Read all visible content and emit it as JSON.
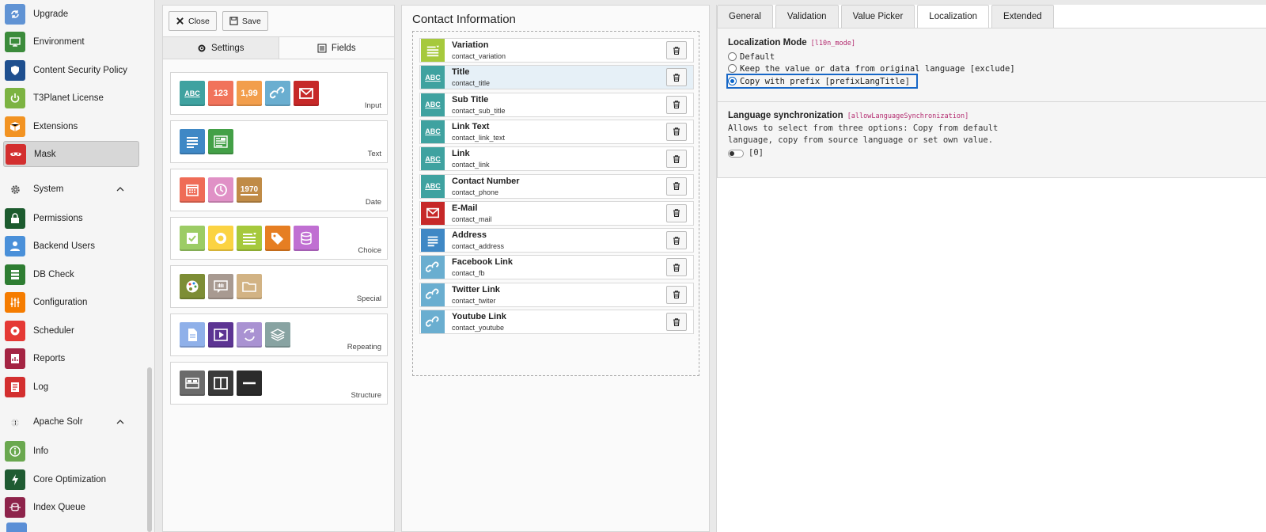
{
  "module_menu": {
    "items": [
      {
        "label": "Upgrade",
        "icon": "upgrade-icon",
        "color": "#6093d4"
      },
      {
        "label": "Environment",
        "icon": "environment-icon",
        "color": "#3b8b3b"
      },
      {
        "label": "Content Security Policy",
        "icon": "shield-icon",
        "color": "#1e4f8f"
      },
      {
        "label": "T3Planet License",
        "icon": "power-icon",
        "color": "#7cb342"
      },
      {
        "label": "Extensions",
        "icon": "box-icon",
        "color": "#f29322"
      },
      {
        "label": "Mask",
        "icon": "mask-icon",
        "color": "#d32f2f"
      }
    ],
    "system_group": {
      "label": "System",
      "icon": "gear-icon"
    },
    "system_items": [
      {
        "label": "Permissions",
        "icon": "lock-icon",
        "color": "#1c5b2e"
      },
      {
        "label": "Backend Users",
        "icon": "user-icon",
        "color": "#4a90d9"
      },
      {
        "label": "DB Check",
        "icon": "database-icon",
        "color": "#2e7d32"
      },
      {
        "label": "Configuration",
        "icon": "sliders-icon",
        "color": "#f57c00"
      },
      {
        "label": "Scheduler",
        "icon": "scheduler-icon",
        "color": "#e53935"
      },
      {
        "label": "Reports",
        "icon": "reports-icon",
        "color": "#a42443"
      },
      {
        "label": "Log",
        "icon": "log-icon",
        "color": "#d32f2f"
      }
    ],
    "solr_group": {
      "label": "Apache Solr",
      "icon": "solr-icon"
    },
    "solr_items": [
      {
        "label": "Info",
        "icon": "info-icon",
        "color": "#6aa84f"
      },
      {
        "label": "Core Optimization",
        "icon": "lightning-icon",
        "color": "#1f5b32"
      },
      {
        "label": "Index Queue",
        "icon": "queue-icon",
        "color": "#8e244b"
      }
    ]
  },
  "toolbar": {
    "close_label": "Close",
    "save_label": "Save"
  },
  "subtabs": {
    "settings": "Settings",
    "fields": "Fields"
  },
  "field_groups": [
    {
      "label": "Input",
      "icons": [
        {
          "name": "string-field-icon",
          "text": "ABC",
          "color": "#3fa2a0"
        },
        {
          "name": "integer-field-icon",
          "text": "123",
          "color": "#f1735b"
        },
        {
          "name": "float-field-icon",
          "text": "1,99",
          "color": "#f29e4c"
        },
        {
          "name": "link-field-icon",
          "text": "",
          "color": "#6aaed0"
        },
        {
          "name": "email-field-icon",
          "text": "",
          "color": "#c62828"
        }
      ]
    },
    {
      "label": "Text",
      "icons": [
        {
          "name": "textarea-field-icon",
          "text": "",
          "color": "#3f88c5"
        },
        {
          "name": "richtext-field-icon",
          "text": "",
          "color": "#43a047"
        }
      ]
    },
    {
      "label": "Date",
      "icons": [
        {
          "name": "date-field-icon",
          "text": "",
          "color": "#ef6c57"
        },
        {
          "name": "time-field-icon",
          "text": "",
          "color": "#e091c6"
        },
        {
          "name": "timestamp-field-icon",
          "text": "1970",
          "color": "#c08b46"
        }
      ]
    },
    {
      "label": "Choice",
      "icons": [
        {
          "name": "checkbox-field-icon",
          "text": "",
          "color": "#9ccc65"
        },
        {
          "name": "radio-field-icon",
          "text": "",
          "color": "#fbd342"
        },
        {
          "name": "select-field-icon",
          "text": "",
          "color": "#a6c93c"
        },
        {
          "name": "category-field-icon",
          "text": "",
          "color": "#e67e22"
        },
        {
          "name": "group-field-icon",
          "text": "",
          "color": "#c06fd2"
        }
      ]
    },
    {
      "label": "Special",
      "icons": [
        {
          "name": "colorpicker-field-icon",
          "text": "",
          "color": "#7d8d35"
        },
        {
          "name": "tab-field-icon",
          "text": "",
          "color": "#a89a91"
        },
        {
          "name": "folder-field-icon",
          "text": "",
          "color": "#d2b384"
        }
      ]
    },
    {
      "label": "Repeating",
      "icons": [
        {
          "name": "file-field-icon",
          "text": "",
          "color": "#8fb0e9"
        },
        {
          "name": "media-field-icon",
          "text": "",
          "color": "#5c3493"
        },
        {
          "name": "inline-field-icon",
          "text": "",
          "color": "#a992d2"
        },
        {
          "name": "content-field-icon",
          "text": "",
          "color": "#88a3a2"
        }
      ]
    },
    {
      "label": "Structure",
      "icons": [
        {
          "name": "palette-field-icon",
          "text": "",
          "color": "#6b6b6b"
        },
        {
          "name": "columns-field-icon",
          "text": "",
          "color": "#3a3a3a"
        },
        {
          "name": "linebreak-field-icon",
          "text": "",
          "color": "#2b2b2b"
        }
      ]
    }
  ],
  "element": {
    "title": "Contact Information",
    "fields": [
      {
        "name": "Variation",
        "key": "contact_variation",
        "icon": "select-field-icon",
        "color": "#a6c93c",
        "text": ""
      },
      {
        "name": "Title",
        "key": "contact_title",
        "icon": "string-field-icon",
        "color": "#3fa2a0",
        "text": "ABC",
        "selected": true
      },
      {
        "name": "Sub Title",
        "key": "contact_sub_title",
        "icon": "string-field-icon",
        "color": "#3fa2a0",
        "text": "ABC"
      },
      {
        "name": "Link Text",
        "key": "contact_link_text",
        "icon": "string-field-icon",
        "color": "#3fa2a0",
        "text": "ABC"
      },
      {
        "name": "Link",
        "key": "contact_link",
        "icon": "string-field-icon",
        "color": "#3fa2a0",
        "text": "ABC"
      },
      {
        "name": "Contact Number",
        "key": "contact_phone",
        "icon": "string-field-icon",
        "color": "#3fa2a0",
        "text": "ABC"
      },
      {
        "name": "E-Mail",
        "key": "contact_mail",
        "icon": "email-field-icon",
        "color": "#c62828",
        "text": ""
      },
      {
        "name": "Address",
        "key": "contact_address",
        "icon": "textarea-field-icon",
        "color": "#3f88c5",
        "text": ""
      },
      {
        "name": "Facebook Link",
        "key": "contact_fb",
        "icon": "link-field-icon",
        "color": "#6aaed0",
        "text": ""
      },
      {
        "name": "Twitter Link",
        "key": "contact_twiter",
        "icon": "link-field-icon",
        "color": "#6aaed0",
        "text": ""
      },
      {
        "name": "Youtube Link",
        "key": "contact_youtube",
        "icon": "link-field-icon",
        "color": "#6aaed0",
        "text": ""
      }
    ]
  },
  "settings_tabs": [
    "General",
    "Validation",
    "Value Picker",
    "Localization",
    "Extended"
  ],
  "active_tab": "Localization",
  "localization": {
    "title": "Localization Mode",
    "key": "[l10n_mode]",
    "options": [
      {
        "label": "Default",
        "checked": false
      },
      {
        "label": "Keep the value or data from original language [exclude]",
        "checked": false
      },
      {
        "label": "Copy with prefix [prefixLangTitle]",
        "checked": true
      }
    ]
  },
  "language_sync": {
    "title": "Language synchronization",
    "key": "[allowLanguageSynchronization]",
    "description_line1": "Allows to select from three options: Copy from default",
    "description_line2": "language, copy from source language or set own value.",
    "value": "[0]"
  }
}
